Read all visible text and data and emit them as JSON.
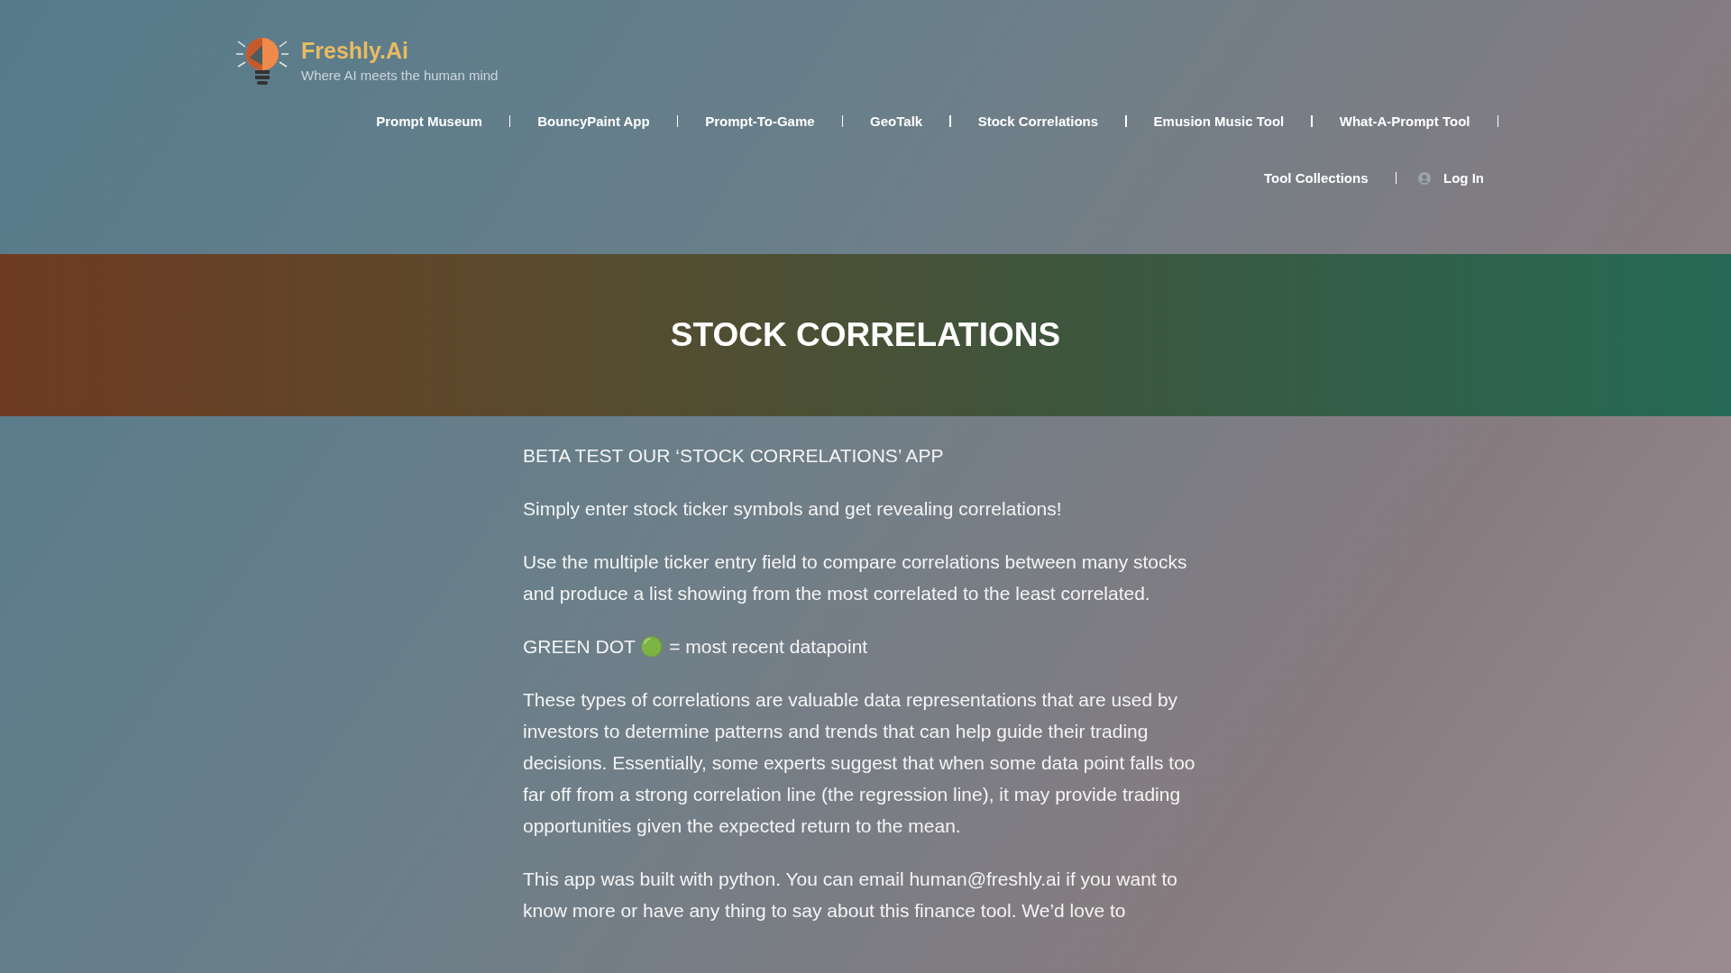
{
  "brand": {
    "name": "Freshly.Ai",
    "tagline": "Where AI meets the human mind"
  },
  "nav": {
    "rows": [
      [
        {
          "label": "Prompt Museum"
        },
        {
          "label": "BouncyPaint App"
        },
        {
          "label": "Prompt-To-Game"
        },
        {
          "label": "GeoTalk"
        },
        {
          "label": "Stock Correlations"
        },
        {
          "label": "Emusion Music Tool"
        },
        {
          "label": "What-A-Prompt Tool"
        }
      ],
      [
        {
          "label": "Tool Collections"
        }
      ]
    ],
    "login": "Log In"
  },
  "hero": {
    "title": "STOCK CORRELATIONS"
  },
  "content": {
    "paragraphs": [
      "BETA TEST OUR ‘STOCK CORRELATIONS’ APP",
      "Simply enter stock ticker symbols and get revealing correlations!",
      "Use the multiple ticker entry field to compare correlations between many stocks and produce a list showing from the most correlated to the least correlated.",
      "GREEN DOT 🟢 = most recent datapoint",
      "These types of correlations are valuable data representations that are used by investors to determine patterns and trends that can help guide their trading decisions. Essentially, some experts suggest that when some data point falls too far off from a strong correlation line (the regression line), it may provide trading opportunities given the expected return to the mean.",
      "This app was built with python. You can email human@freshly.ai if you want to know more or have any thing to say about this finance tool. We’d love to"
    ]
  }
}
